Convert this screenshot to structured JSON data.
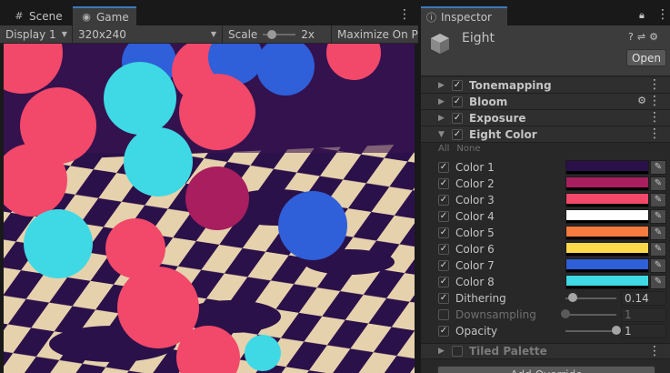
{
  "tabs": {
    "scene": "Scene",
    "game": "Game",
    "inspector": "Inspector"
  },
  "game_toolbar": {
    "display": "Display 1",
    "resolution": "320x240",
    "scale_label": "Scale",
    "scale_value": "2x",
    "maximize": "Maximize On Pla"
  },
  "inspector": {
    "asset_name": "Eight",
    "open_button": "Open",
    "all": "All",
    "none": "None",
    "add_button": "Add Override"
  },
  "sections": [
    {
      "title": "Tonemapping",
      "enabled": true
    },
    {
      "title": "Bloom",
      "enabled": true
    },
    {
      "title": "Exposure",
      "enabled": true
    },
    {
      "title": "Eight Color",
      "enabled": true
    },
    {
      "title": "Tiled Palette",
      "enabled": false
    }
  ],
  "colors": [
    {
      "label": "Color 1",
      "hex": "#2b1149",
      "checked": true
    },
    {
      "label": "Color 2",
      "hex": "#a81e5e",
      "checked": true
    },
    {
      "label": "Color 3",
      "hex": "#f2486a",
      "checked": true
    },
    {
      "label": "Color 4",
      "hex": "#ffffff",
      "checked": true
    },
    {
      "label": "Color 5",
      "hex": "#f77a3e",
      "checked": true
    },
    {
      "label": "Color 6",
      "hex": "#fcd94a",
      "checked": true
    },
    {
      "label": "Color 7",
      "hex": "#2f5fd9",
      "checked": true
    },
    {
      "label": "Color 8",
      "hex": "#3ed9e5",
      "checked": true
    }
  ],
  "params": [
    {
      "label": "Dithering",
      "value": "0.14",
      "slider": 0.14,
      "checked": true
    },
    {
      "label": "Downsampling",
      "value": "1",
      "slider": 0.0,
      "checked": false
    },
    {
      "label": "Opacity",
      "value": "1",
      "slider": 1.0,
      "checked": true
    }
  ],
  "icons": {
    "scene": "grid-icon",
    "game": "gamepad-icon",
    "inspector": "info-icon",
    "lock": "lock-icon",
    "menu": "kebab-menu-icon",
    "help": "help-icon",
    "preset": "sliders-icon",
    "settings": "gear-icon",
    "eyedropper": "eyedropper-icon"
  }
}
